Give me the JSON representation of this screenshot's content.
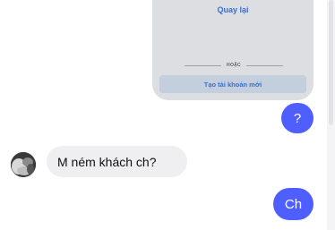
{
  "shared_card": {
    "link_text": "Quay lại",
    "divider_text": "HOẶC",
    "button_text": "Tạo tài khoản mới",
    "background": "#dcdee2",
    "link_color": "#3b6fd0"
  },
  "messages": {
    "outgoing_1": "?",
    "incoming_1": "M ném khách ch?",
    "outgoing_2": "Ch"
  },
  "colors": {
    "outgoing_bubble": "#4f5fff",
    "incoming_bubble": "#efeff2"
  },
  "icons": {
    "avatar": "user-avatar-photo"
  }
}
